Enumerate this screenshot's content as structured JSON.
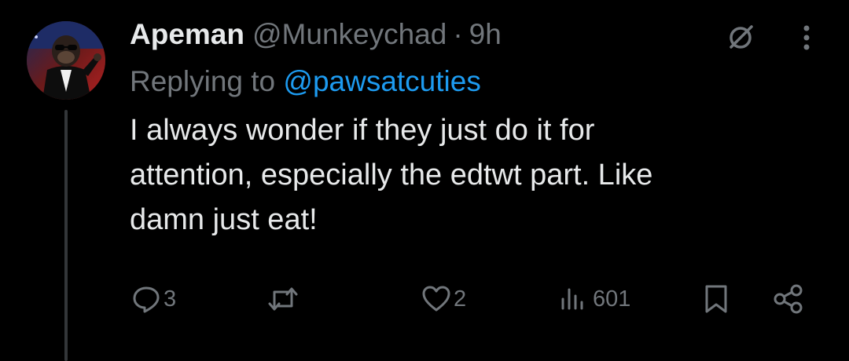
{
  "tweet": {
    "display_name": "Apeman",
    "handle": "@Munkeychad",
    "separator": "·",
    "time": "9h",
    "replying_prefix": "Replying to ",
    "replying_to": "@pawsatcuties",
    "text_lines": [
      "I always wonder if they just do it for",
      "attention, especially the edtwt part. Like",
      "damn just eat!"
    ]
  },
  "actions": {
    "reply_count": "3",
    "like_count": "2",
    "views_count": "601"
  },
  "icons": {
    "grok": "grok-icon",
    "more": "more-icon",
    "reply": "reply-icon",
    "retweet": "retweet-icon",
    "like": "heart-icon",
    "views": "views-icon",
    "bookmark": "bookmark-icon",
    "share": "share-icon"
  },
  "colors": {
    "background": "#000000",
    "primary_text": "#e7e9ea",
    "secondary_text": "#71767b",
    "link": "#1d9bf0",
    "thread_line": "#333639"
  }
}
